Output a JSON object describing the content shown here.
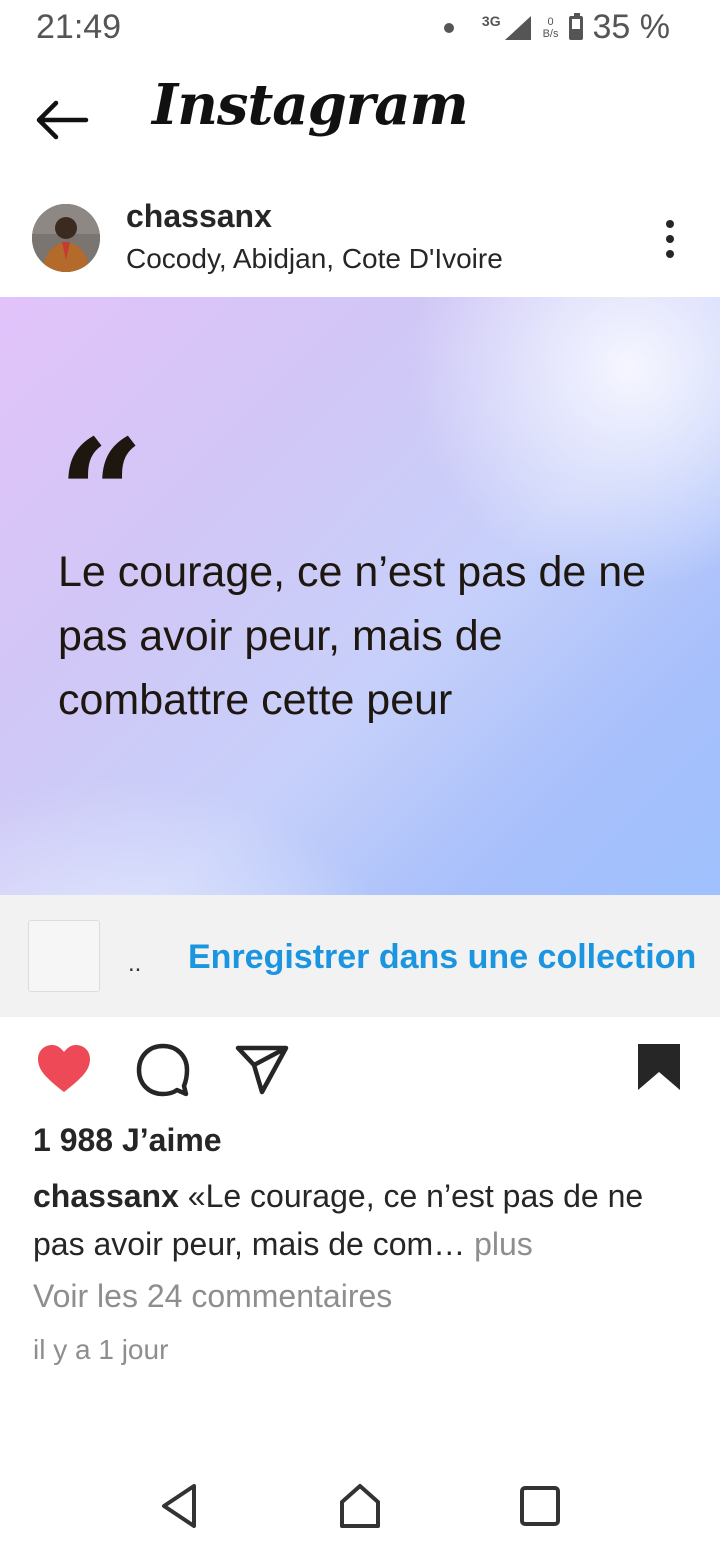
{
  "status_bar": {
    "time": "21:49",
    "network": "3G",
    "data_rate_value": "0",
    "data_rate_unit": "B/s",
    "battery": "35 %"
  },
  "header": {
    "app_title": "Instagram",
    "back_icon": "arrow-left-icon"
  },
  "post": {
    "username": "chassanx",
    "location": "Cocody, Abidjan, Cote D'Ivoire",
    "menu_icon": "more-vertical-icon",
    "image": {
      "quote_mark": "“",
      "quote_text": "Le courage, ce n’est pas de ne pas avoir peur, mais de combattre cette peur"
    },
    "collection": {
      "dots": "..",
      "save_link": "Enregistrer dans une collection"
    },
    "actions": {
      "like_icon": "heart-filled-icon",
      "comment_icon": "comment-icon",
      "share_icon": "send-icon",
      "save_icon": "bookmark-filled-icon",
      "like_color": "#ed4956"
    },
    "likes": "1 988 J’aime",
    "caption_username": "chassanx",
    "caption_text": "«Le courage, ce n’est pas de ne pas avoir peur, mais de com…",
    "caption_more": "plus",
    "view_comments": "Voir les 24 commentaires",
    "timestamp": "il y a 1 jour"
  },
  "navigation": {
    "back_icon": "nav-back-icon",
    "home_icon": "nav-home-icon",
    "recent_icon": "nav-recent-apps-icon"
  }
}
